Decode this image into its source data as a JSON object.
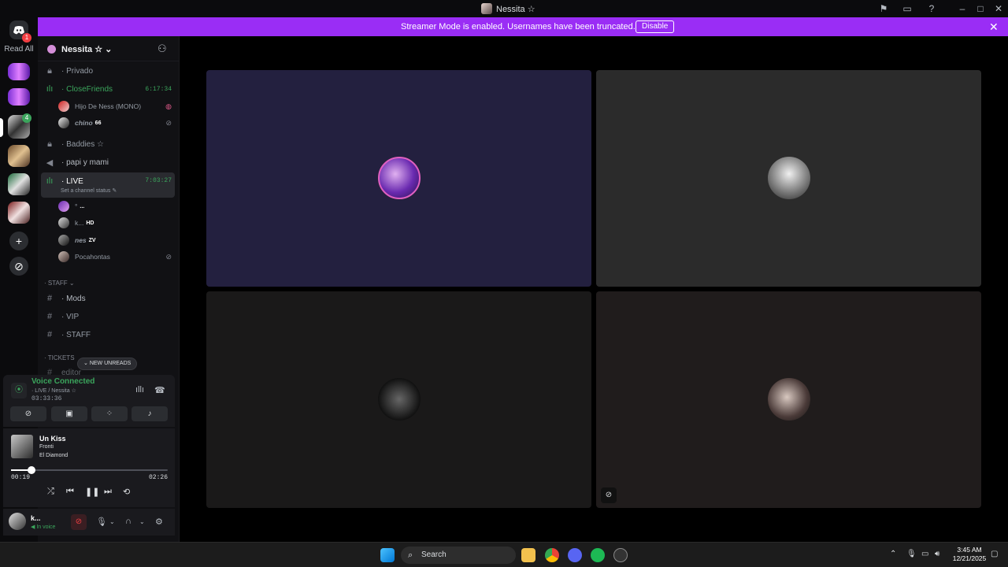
{
  "window": {
    "title": "Nessita ☆"
  },
  "banner": {
    "message": "Streamer Mode is enabled. Usernames have been truncated.",
    "disable_label": "Disable"
  },
  "guild_rail": {
    "read_all_label": "Read All",
    "discord_badge": "1",
    "folder_badge": "4"
  },
  "server": {
    "name": "Nessita ☆ ⌄"
  },
  "channels": {
    "privado": "Privado",
    "closefriends": "CloseFriends",
    "closefriends_time": "6:17:34",
    "closefriends_users": [
      {
        "name": "Hijo De Ness (MONO)"
      },
      {
        "name": "chino",
        "tag": "66"
      }
    ],
    "baddies": "Baddies ☆",
    "papi": "papi y mami",
    "live": "LIVE",
    "live_time": "7:03:27",
    "live_status": "Set a channel status",
    "live_users": [
      {
        "name": "°",
        "tag": "..."
      },
      {
        "name": "k...",
        "tag": "HD"
      },
      {
        "name": "nes",
        "tag": "ZV"
      },
      {
        "name": "Pocahontas",
        "tag": ""
      }
    ],
    "staff_category": "STAFF",
    "mods": "Mods",
    "vip": "VIP",
    "staff": "STAFF",
    "tickets_category": "TICKETS",
    "editor": "editor",
    "new_unreads": "NEW UNREADS"
  },
  "voice_panel": {
    "status": "Voice Connected",
    "channel": "LIVE / Nessita ☆",
    "elapsed": "03:33:36"
  },
  "music": {
    "song": "Un Kiss",
    "artist": "Fronti",
    "album": "El Diamond",
    "position": "00:19",
    "duration": "02:26",
    "progress": 0.13
  },
  "user_panel": {
    "name": "k...",
    "status": "In voice"
  },
  "taskbar": {
    "search_placeholder": "Search",
    "time": "3:45 AM",
    "date": "12/21/2025"
  },
  "colors": {
    "accent_banner": "#9a2df5",
    "voice_green": "#3ba55c",
    "tile_active": "#23203f"
  }
}
